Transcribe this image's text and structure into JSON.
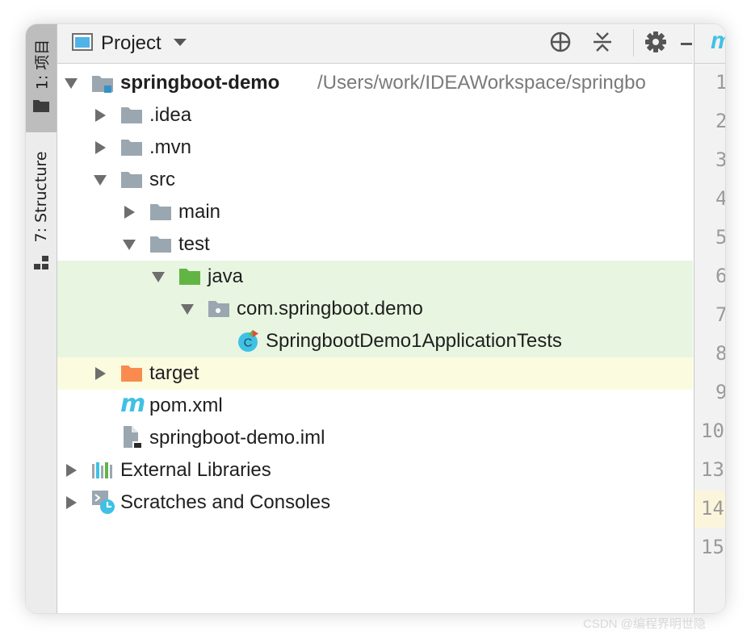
{
  "sidebar_tabs": [
    {
      "label": "1: 项目",
      "icon": "folder-icon"
    },
    {
      "label": "7: Structure",
      "icon": "structure-icon"
    }
  ],
  "toolbar": {
    "title": "Project",
    "title_icon": "project-window-icon",
    "dropdown_icon": "chevron-down-icon",
    "buttons": [
      "locate-icon",
      "collapse-all-icon",
      "gear-icon",
      "minimize-icon"
    ]
  },
  "tree": {
    "root_name": "springboot-demo",
    "root_path": "/Users/work/IDEAWorkspace/springbo",
    "items": [
      {
        "label": ".idea"
      },
      {
        "label": ".mvn"
      },
      {
        "label": "src"
      },
      {
        "label": "main"
      },
      {
        "label": "test"
      },
      {
        "label": "java"
      },
      {
        "label": "com.springboot.demo"
      },
      {
        "label": "SpringbootDemo1ApplicationTests"
      },
      {
        "label": "target"
      },
      {
        "label": "pom.xml"
      },
      {
        "label": "springboot-demo.iml"
      },
      {
        "label": "External Libraries"
      },
      {
        "label": "Scratches and Consoles"
      }
    ]
  },
  "editor": {
    "tab_icon_letter": "m",
    "line_numbers": [
      "1",
      "2",
      "3",
      "4",
      "5",
      "6",
      "7",
      "8",
      "9",
      "10",
      "13",
      "14",
      "15"
    ],
    "current_line": "14"
  },
  "colors": {
    "test_sources_bg": "#e8f5e1",
    "excluded_bg": "#fbfbdf",
    "folder": "#9aa7b0",
    "test_folder": "#62b543",
    "excluded_folder": "#f98b4f",
    "accent": "#3fc1e5"
  },
  "watermark": "CSDN @编程界明世隐"
}
